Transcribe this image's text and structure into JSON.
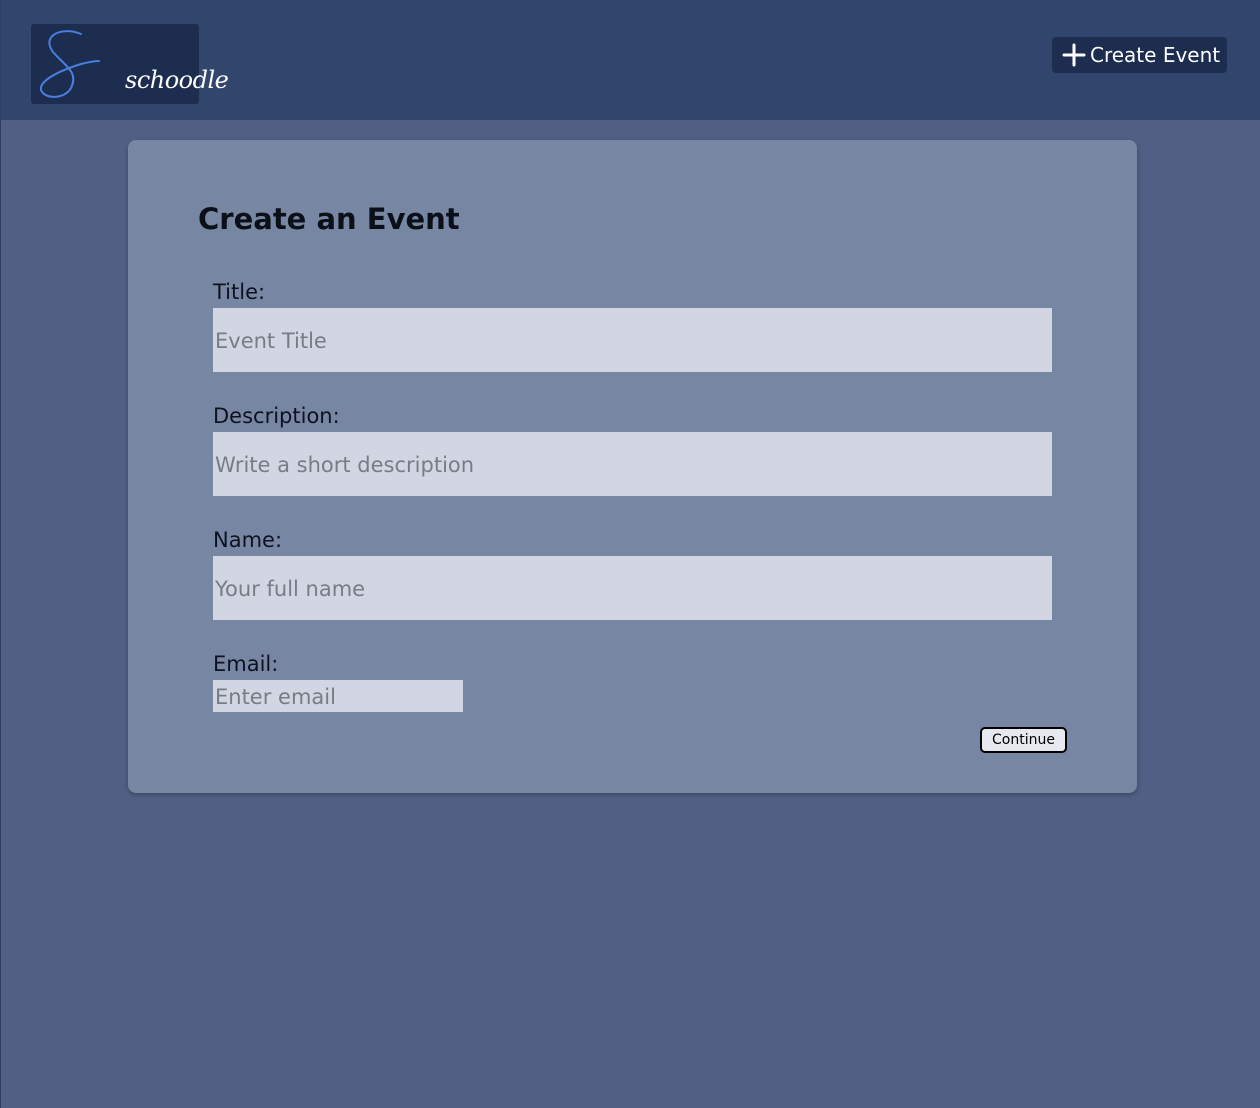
{
  "header": {
    "logo_text": "schoodle",
    "create_button_label": "Create Event",
    "colors": {
      "bar": "#32456d",
      "logo_bg": "#1d2d4f",
      "logo_accent": "#4a7ee0"
    }
  },
  "form": {
    "title": "Create an Event",
    "fields": [
      {
        "label": "Title:",
        "placeholder": "Event Title"
      },
      {
        "label": "Description:",
        "placeholder": "Write a short description"
      },
      {
        "label": "Name:",
        "placeholder": "Your full name"
      },
      {
        "label": "Email:",
        "placeholder": "Enter email"
      }
    ],
    "submit_label": "Continue"
  }
}
